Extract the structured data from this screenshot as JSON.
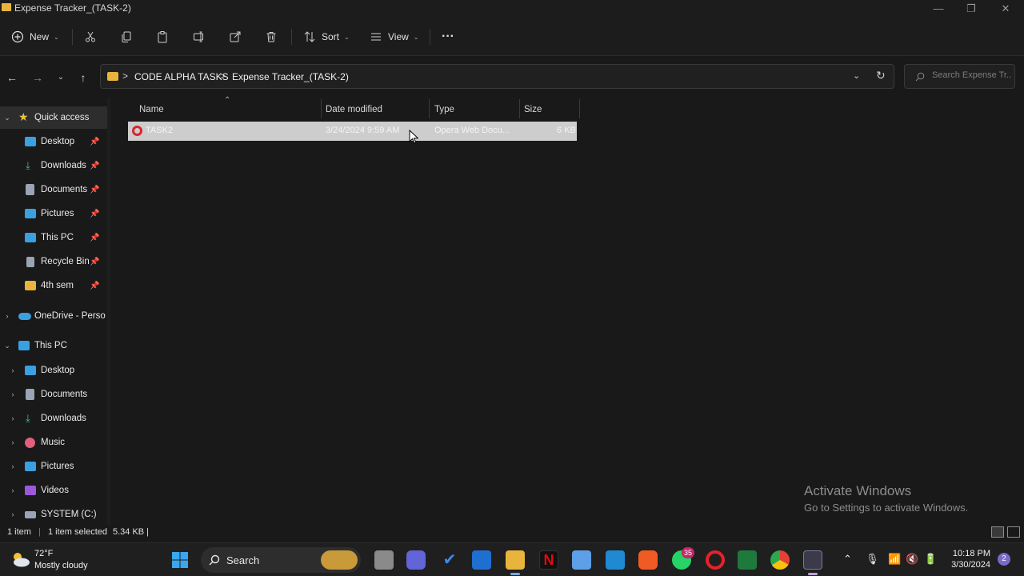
{
  "window": {
    "title": "Expense Tracker_(TASK-2)",
    "minimize": "—",
    "maximize": "❐",
    "close": "✕"
  },
  "toolbar": {
    "new_label": "New",
    "sort_label": "Sort",
    "view_label": "View",
    "more_label": "···"
  },
  "address": {
    "breadcrumbs": [
      "CODE ALPHA TASKS",
      "Expense Tracker_(TASK-2)"
    ],
    "separator": ">",
    "search_placeholder": "Search Expense Tr..."
  },
  "sidebar": {
    "quick_access": {
      "label": "Quick access",
      "items": [
        {
          "label": "Desktop",
          "icon": "desktop-icon",
          "color": "#3aa0e0"
        },
        {
          "label": "Downloads",
          "icon": "download-icon",
          "color": "#3cc47c"
        },
        {
          "label": "Documents",
          "icon": "documents-icon",
          "color": "#9aa4b4"
        },
        {
          "label": "Pictures",
          "icon": "pictures-icon",
          "color": "#3aa0e0"
        },
        {
          "label": "This PC",
          "icon": "monitor-icon",
          "color": "#3aa0e0"
        },
        {
          "label": "Recycle Bin",
          "icon": "recycle-bin-icon",
          "color": "#9aa4b4"
        },
        {
          "label": "4th sem",
          "icon": "folder-icon",
          "color": "#e8b43c"
        }
      ]
    },
    "onedrive": {
      "label": "OneDrive - Perso"
    },
    "this_pc": {
      "label": "This PC",
      "items": [
        {
          "label": "Desktop",
          "icon": "desktop-icon",
          "color": "#3aa0e0"
        },
        {
          "label": "Documents",
          "icon": "documents-icon",
          "color": "#9aa4b4"
        },
        {
          "label": "Downloads",
          "icon": "download-icon",
          "color": "#3cc47c"
        },
        {
          "label": "Music",
          "icon": "music-icon",
          "color": "#e0607c"
        },
        {
          "label": "Pictures",
          "icon": "pictures-icon",
          "color": "#3aa0e0"
        },
        {
          "label": "Videos",
          "icon": "videos-icon",
          "color": "#9a5ad8"
        },
        {
          "label": "SYSTEM (C:)",
          "icon": "drive-icon",
          "color": "#9aa4b4"
        }
      ]
    }
  },
  "columns": {
    "name": "Name",
    "date": "Date modified",
    "type": "Type",
    "size": "Size"
  },
  "files": [
    {
      "name": "TASK2",
      "date": "3/24/2024 9:59 AM",
      "type": "Opera Web Docu...",
      "size": "6 KB"
    }
  ],
  "watermark": {
    "line1": "Activate Windows",
    "line2": "Go to Settings to activate Windows."
  },
  "status": {
    "count": "1 item",
    "selected": "1 item selected",
    "size": "5.34 KB",
    "bar": "|"
  },
  "taskbar": {
    "temp": "72°F",
    "condition": "Mostly cloudy",
    "search_label": "Search",
    "whatsapp_badge": "35",
    "time": "10:18 PM",
    "date": "3/30/2024",
    "notification_count": "2"
  }
}
